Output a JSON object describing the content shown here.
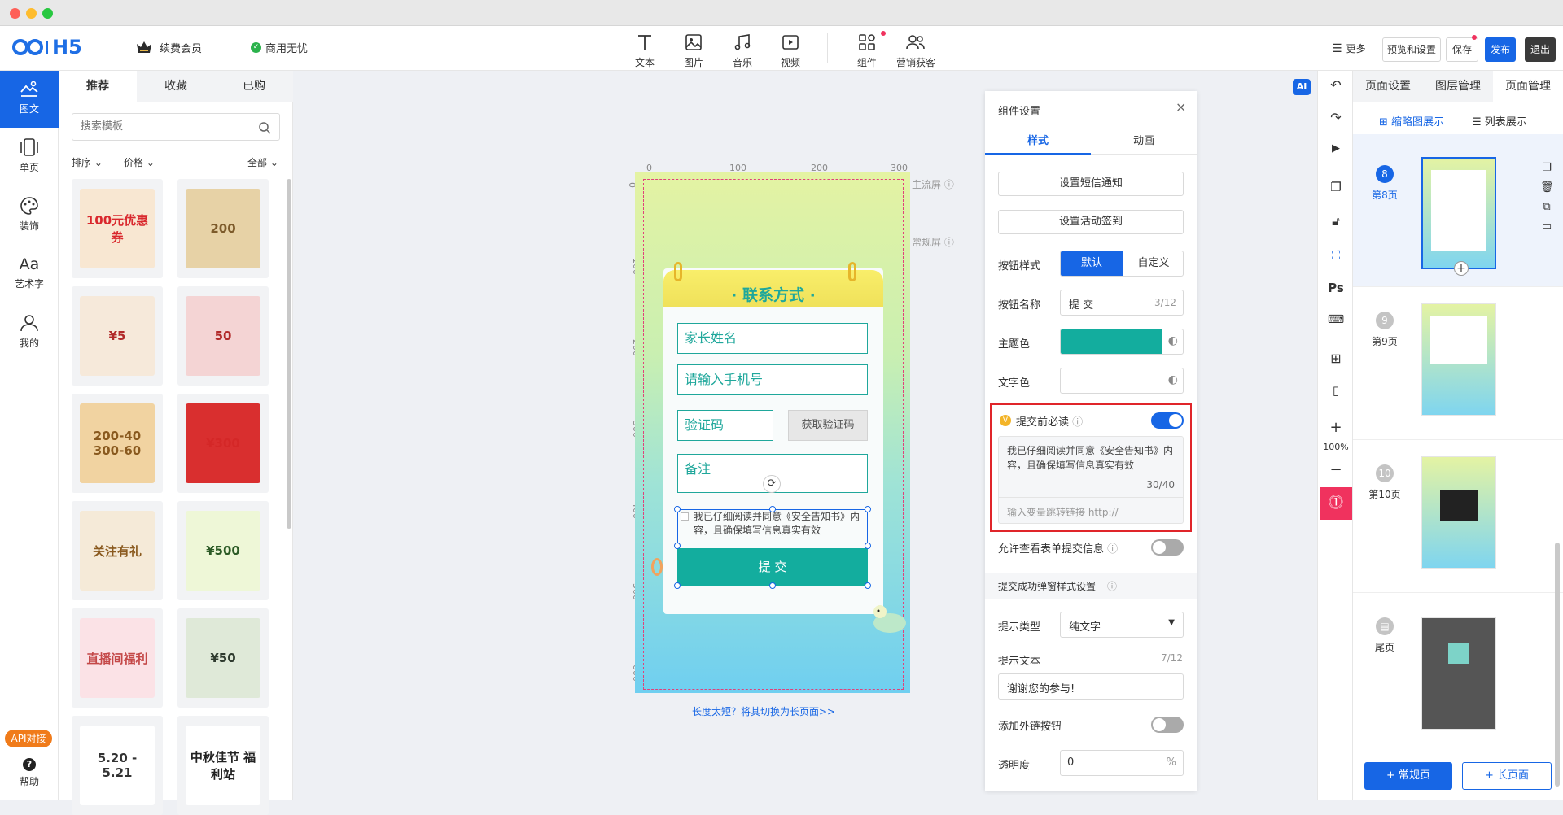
{
  "topbar": {
    "logo": "H5",
    "vip": "续费会员",
    "commercial": "商用无忧",
    "tools": [
      "文本",
      "图片",
      "音乐",
      "视频",
      "组件",
      "营销获客"
    ],
    "more": "更多",
    "preview": "预览和设置",
    "save": "保存",
    "publish": "发布",
    "exit": "退出"
  },
  "leftnav": [
    {
      "label": "图文",
      "icon": "image-text-icon"
    },
    {
      "label": "单页",
      "icon": "single-page-icon"
    },
    {
      "label": "装饰",
      "icon": "palette-icon"
    },
    {
      "label": "艺术字",
      "icon": "art-text-icon"
    },
    {
      "label": "我的",
      "icon": "user-icon"
    }
  ],
  "api_badge": "API对接",
  "help": "帮助",
  "library": {
    "tabs": [
      "推荐",
      "收藏",
      "已购"
    ],
    "search_placeholder": "搜索模板",
    "sort": "排序",
    "price": "价格",
    "all": "全部",
    "cards": [
      {
        "text": "100元优惠券",
        "color": "#d9282d",
        "bg": "#f8e7d2"
      },
      {
        "text": "200",
        "color": "#7d5b2b",
        "bg": "#e7d2a6"
      },
      {
        "text": "¥5",
        "color": "#b22a2a",
        "bg": "#f6e9da"
      },
      {
        "text": "50",
        "color": "#b22a2a",
        "bg": "#f4d4d4"
      },
      {
        "text": "200-40 300-60",
        "color": "#8a5a1f",
        "bg": "#f1d3a1"
      },
      {
        "text": "¥300",
        "color": "#d42727",
        "bg": "#d92f2f"
      },
      {
        "text": "关注有礼",
        "color": "#8a5a1f",
        "bg": "#f5ead8"
      },
      {
        "text": "¥500",
        "color": "#2c5b26",
        "bg": "#eef7d7"
      },
      {
        "text": "直播间福利",
        "color": "#c44848",
        "bg": "#fbe2e6"
      },
      {
        "text": "¥50",
        "color": "#2f3b2f",
        "bg": "#dfe9d8"
      },
      {
        "text": "5.20 - 5.21",
        "color": "#333",
        "bg": "#fff"
      },
      {
        "text": "中秋佳节 福利站",
        "color": "#222",
        "bg": "#fff"
      }
    ]
  },
  "canvas": {
    "ruler_marks": [
      "0",
      "100",
      "200",
      "300"
    ],
    "ruler_v": [
      "0",
      "100",
      "200",
      "300",
      "400",
      "500",
      "600"
    ],
    "main_screen": "主流屏",
    "normal_screen": "常规屏",
    "form_title": "· 联系方式 ·",
    "field1": "家长姓名",
    "field2": "请输入手机号",
    "field3": "验证码",
    "code_btn": "获取验证码",
    "field4": "备注",
    "agree": "我已仔细阅读并同意《安全告知书》内容，且确保填写信息真实有效",
    "submit": "提 交",
    "too_short": "长度太短？将其切换为长页面>>",
    "ai": "AI"
  },
  "panel": {
    "title": "组件设置",
    "tab_style": "样式",
    "tab_anim": "动画",
    "sms": "设置短信通知",
    "checkin": "设置活动签到",
    "btn_style_label": "按钮样式",
    "btn_default": "默认",
    "btn_custom": "自定义",
    "btn_name_label": "按钮名称",
    "btn_name_value": "提 交",
    "btn_name_count": "3/12",
    "theme_label": "主题色",
    "theme_color": "#13ad9e",
    "text_color_label": "文字色",
    "must_read": "提交前必读",
    "must_read_text": "我已仔细阅读并同意《安全告知书》内容，且确保填写信息真实有效",
    "must_read_count": "30/40",
    "link_placeholder": "输入变量跳转链接 http://",
    "allow_view": "允许查看表单提交信息",
    "success_title": "提交成功弹窗样式设置",
    "tip_type_label": "提示类型",
    "tip_type_value": "纯文字",
    "tip_text_label": "提示文本",
    "tip_text_count": "7/12",
    "tip_text_value": "谢谢您的参与!",
    "ext_link": "添加外链按钮",
    "opacity_label": "透明度",
    "opacity_value": "0",
    "opacity_unit": "%"
  },
  "rtools": {
    "zoom": "100%",
    "ps": "Ps"
  },
  "rpanel": {
    "tabs": [
      "页面设置",
      "图层管理",
      "页面管理"
    ],
    "view_thumb": "缩略图展示",
    "view_list": "列表展示",
    "pages": [
      {
        "num": "8",
        "label": "第8页"
      },
      {
        "num": "9",
        "label": "第9页"
      },
      {
        "num": "10",
        "label": "第10页"
      },
      {
        "num": "",
        "label": "尾页"
      }
    ],
    "add_normal": "+ 常规页",
    "add_long": "+ 长页面"
  }
}
